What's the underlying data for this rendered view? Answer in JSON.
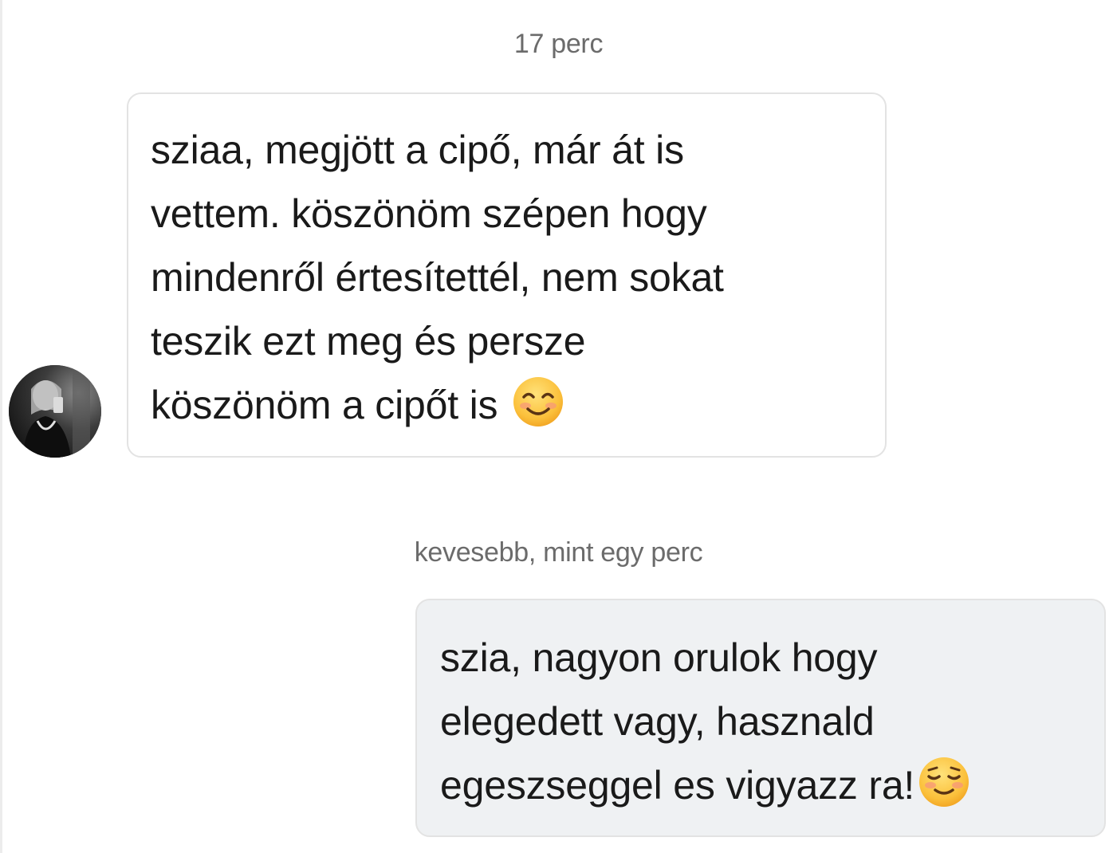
{
  "conversation": {
    "messages": [
      {
        "timestamp": "17 perc",
        "direction": "incoming",
        "lines": [
          "sziaa, megjött a cipő, már át is",
          "vettem. köszönöm szépen hogy",
          "mindenről értesítettél, nem sokat",
          "teszik ezt meg és persze",
          "köszönöm a cipőt is"
        ],
        "emoji": "smiling-face-with-smiling-eyes-icon"
      },
      {
        "timestamp": "kevesebb, mint egy perc",
        "direction": "outgoing",
        "lines": [
          "szia, nagyon orulok hogy",
          "elegedett vagy, hasznald",
          "egeszseggel es vigyazz ra!"
        ],
        "emoji": "smiling-face-icon"
      }
    ]
  },
  "colors": {
    "incoming_bubble_bg": "#ffffff",
    "outgoing_bubble_bg": "#eff1f3",
    "bubble_border": "#e3e3e3",
    "timestamp_text": "#6b6b6b",
    "message_text": "#1a1a1a"
  },
  "icons": {
    "avatar": "avatar-photo"
  }
}
